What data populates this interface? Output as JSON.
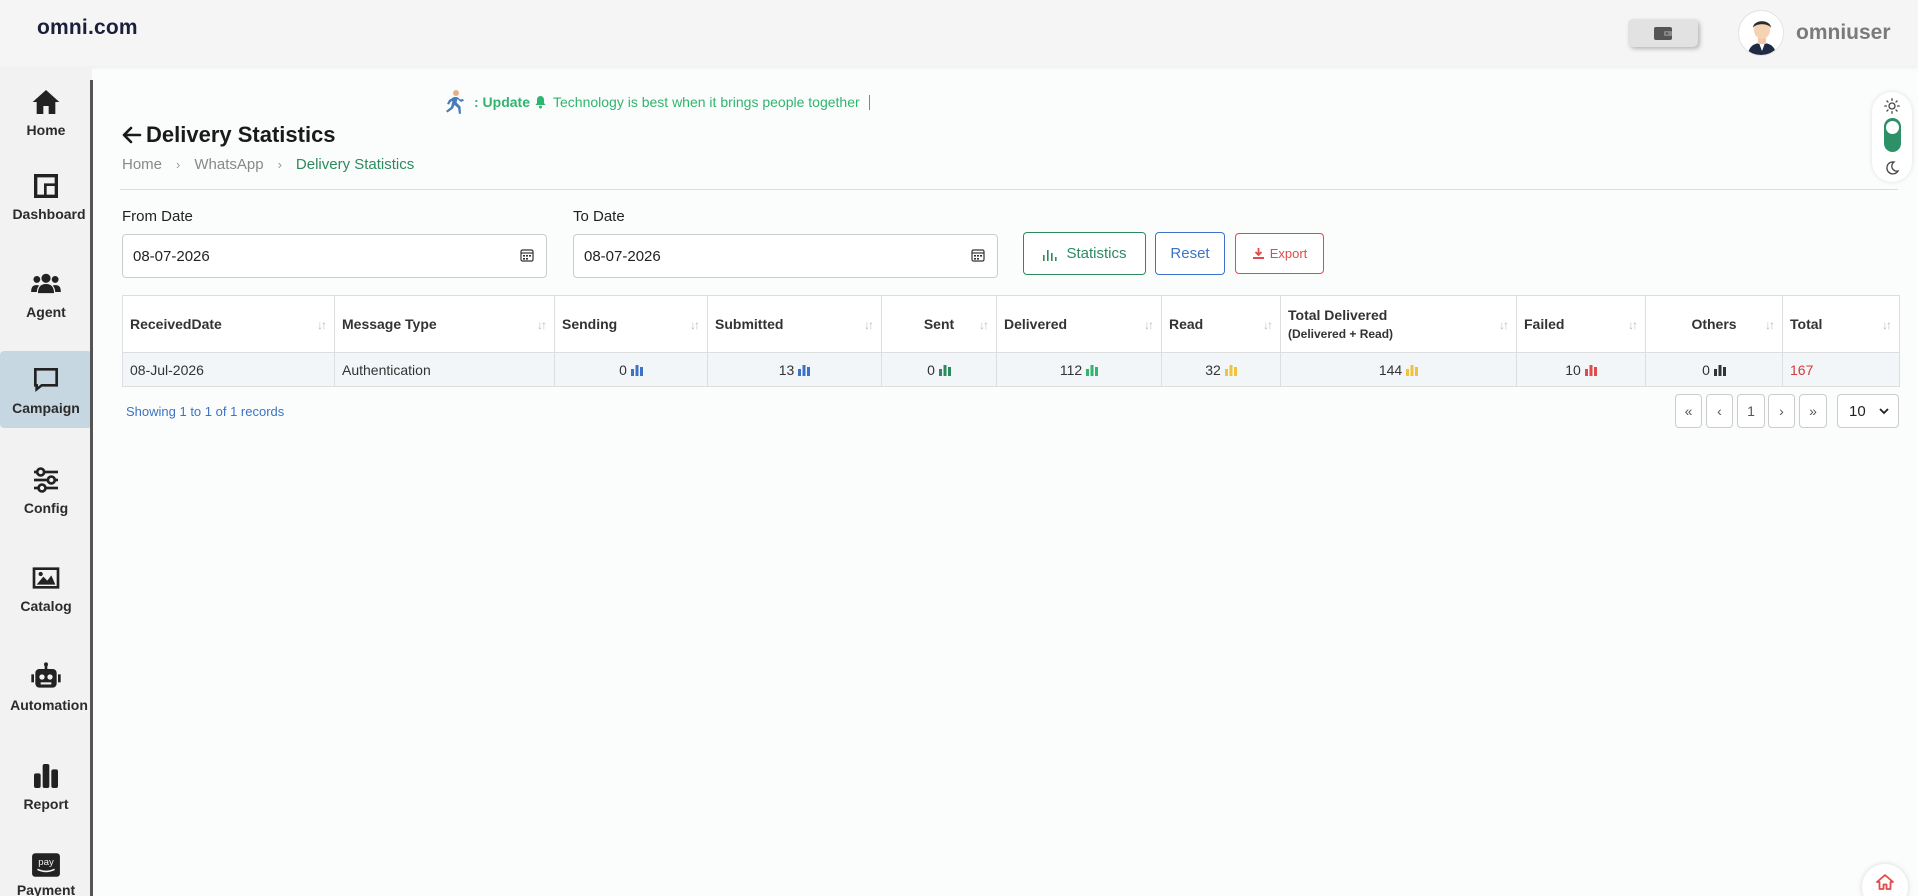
{
  "header": {
    "brand": "omni.com",
    "username": "omniuser"
  },
  "sidebar": {
    "items": [
      {
        "label": "Home",
        "icon": "home-icon"
      },
      {
        "label": "Dashboard",
        "icon": "dashboard-icon"
      },
      {
        "label": "Agent",
        "icon": "users-icon"
      },
      {
        "label": "Campaign",
        "icon": "chat-icon"
      },
      {
        "label": "Config",
        "icon": "sliders-icon"
      },
      {
        "label": "Catalog",
        "icon": "image-icon"
      },
      {
        "label": "Automation",
        "icon": "robot-icon"
      },
      {
        "label": "Report",
        "icon": "bar-chart-icon"
      },
      {
        "label": "Payment",
        "icon": "amazon-pay-icon"
      }
    ],
    "active": "Campaign"
  },
  "ticker": {
    "prefix": ": Update",
    "message": "Technology is best when it brings people together"
  },
  "page": {
    "title": "Delivery Statistics",
    "breadcrumb": [
      "Home",
      "WhatsApp",
      "Delivery Statistics"
    ]
  },
  "filters": {
    "from_label": "From Date",
    "from_value": "08-07-2026",
    "to_label": "To Date",
    "to_value": "08-07-2026",
    "statistics_label": "Statistics",
    "reset_label": "Reset",
    "export_label": "Export"
  },
  "table": {
    "headers": {
      "received_date": "ReceivedDate",
      "message_type": "Message Type",
      "sending": "Sending",
      "submitted": "Submitted",
      "sent": "Sent",
      "delivered": "Delivered",
      "read": "Read",
      "total_delivered": "Total Delivered",
      "total_delivered_sub": "(Delivered + Read)",
      "failed": "Failed",
      "others": "Others",
      "total": "Total"
    },
    "rows": [
      {
        "received_date": "08-Jul-2026",
        "message_type": "Authentication",
        "sending": "0",
        "submitted": "13",
        "sent": "0",
        "delivered": "112",
        "read": "32",
        "total_delivered": "144",
        "failed": "10",
        "others": "0",
        "total": "167"
      }
    ]
  },
  "pagination": {
    "summary": "Showing 1 to 1 of 1 records",
    "first": "«",
    "prev": "‹",
    "current": "1",
    "next": "›",
    "last": "»",
    "per_page": "10"
  },
  "colors": {
    "accent_green": "#2d8a5f",
    "accent_blue": "#3c73c6",
    "danger_red": "#e04b4b",
    "ticker_green": "#2fb56d",
    "bar_blue": "#3c73c6",
    "bar_green": "#2fb56d",
    "bar_yellow": "#f2c23b",
    "bar_red": "#e04b4b",
    "bar_dark": "#333333"
  }
}
